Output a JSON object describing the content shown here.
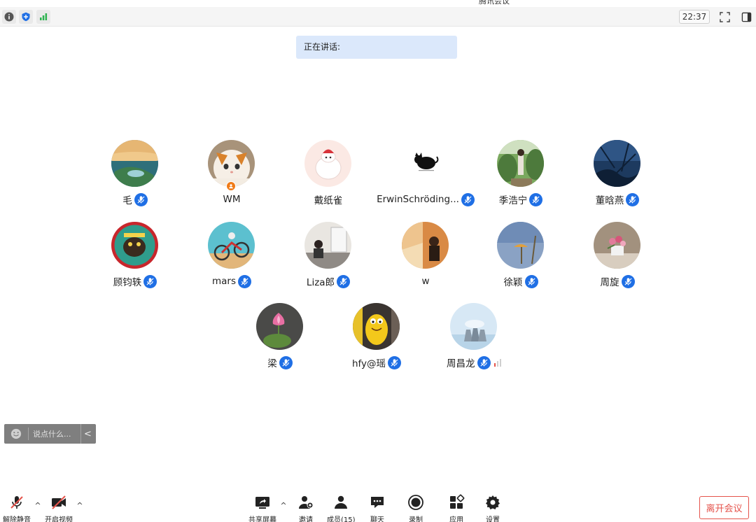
{
  "window": {
    "title": "腾讯会议"
  },
  "topbar": {
    "time": "22:37",
    "icons": [
      "info-icon",
      "shield-icon",
      "signal-icon",
      "fullscreen-icon",
      "sidebar-icon"
    ]
  },
  "speaking": {
    "label": "正在讲话:"
  },
  "participants": [
    {
      "name": "毛",
      "mic": true
    },
    {
      "name": "WM",
      "mic": false,
      "host": true
    },
    {
      "name": "戴纸雀",
      "mic": false
    },
    {
      "name": "ErwinSchröding...",
      "mic": true
    },
    {
      "name": "季浩宁",
      "mic": true
    },
    {
      "name": "董晗燕",
      "mic": true
    },
    {
      "name": "顾钧轶",
      "mic": true
    },
    {
      "name": "mars",
      "mic": true
    },
    {
      "name": "Liza郎",
      "mic": true
    },
    {
      "name": "w",
      "mic": false
    },
    {
      "name": "徐颖",
      "mic": true
    },
    {
      "name": "周旋",
      "mic": true
    },
    {
      "name": "梁",
      "mic": true
    },
    {
      "name": "hfy@瑶",
      "mic": true
    },
    {
      "name": "周昌龙",
      "mic": true,
      "signal": true
    }
  ],
  "chat": {
    "placeholder": "说点什么...",
    "collapse": "<"
  },
  "toolbar": {
    "unmute": "解除静音",
    "start_video": "开启视频",
    "share_screen": "共享屏幕",
    "invite": "邀请",
    "members": "成员(15)",
    "chat": "聊天",
    "record": "录制",
    "apps": "应用",
    "settings": "设置",
    "leave": "离开会议"
  },
  "colors": {
    "accent": "#1f6fe5",
    "leave": "#e5534b",
    "banner": "#dbe8fb"
  }
}
